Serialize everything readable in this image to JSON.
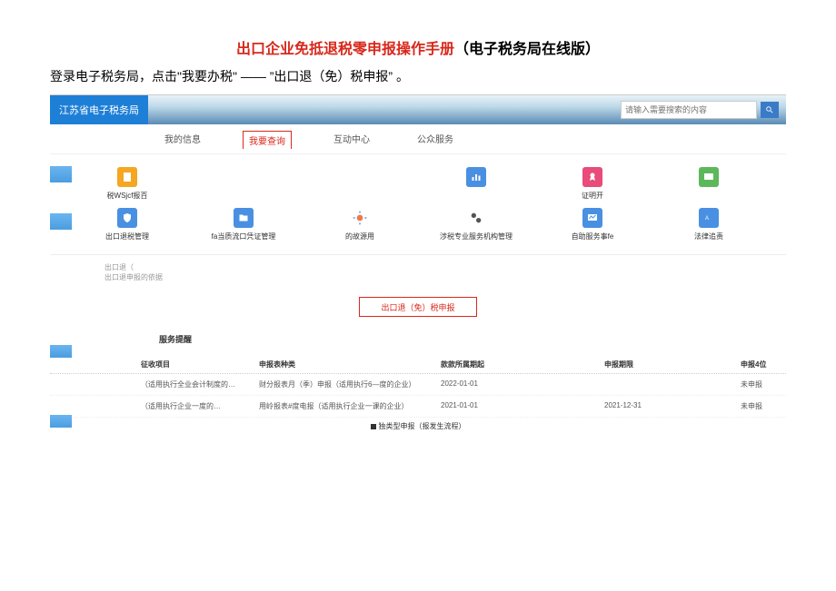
{
  "doc": {
    "title_red": "出口企业免抵退税零申报操作手册",
    "title_black": "（电子税务局在线版）",
    "intro_prefix": "登录电子税务局，点击\"我要办税\"",
    "intro_arrow": " —— ",
    "intro_quoted": "”出口退（免）税申报”",
    "intro_suffix": " 。"
  },
  "header": {
    "logo": "江苏省电子税务局",
    "search_placeholder": "请输入需要搜索的内容"
  },
  "nav": {
    "items": [
      "我的信息",
      "我要查询",
      "互动中心",
      "公众服务"
    ],
    "active_index": 1
  },
  "icons_row1": [
    {
      "label": "税WSjcf报百",
      "color": "#f5a623"
    },
    {
      "label": "",
      "color": ""
    },
    {
      "label": "",
      "color": ""
    },
    {
      "label": "",
      "color": "#4a90e2"
    },
    {
      "label": "证明开",
      "color": "#e94b7a"
    },
    {
      "label": "",
      "color": "#5db85c"
    }
  ],
  "icons_row2": [
    {
      "label": "出口退税管理",
      "color": "#4a90e2"
    },
    {
      "label": "fa当质流口凭证管理",
      "color": "#4a90e2"
    },
    {
      "label": "的故源用",
      "color": "#f07848"
    },
    {
      "label": "涉税专业服务机构管理",
      "color": "#555"
    },
    {
      "label": "自助服务事fe",
      "color": "#4a90e2"
    },
    {
      "label": "法律追责",
      "color": "#4a90e2"
    }
  ],
  "section": {
    "line1": "出口退（",
    "line2": "出口退申报的依据"
  },
  "highlight_button": "出口退（免）税申报",
  "reminder": {
    "title": "服务提醒",
    "headers": [
      "征收项目",
      "申报表种类",
      "款款所属期起",
      "申报期限",
      "申报4位"
    ],
    "rows": [
      {
        "c1": "（适用执行全业会计制度的…",
        "c2": "财分报表月（季）申报（适用执行6—度的企业）",
        "c3": "2022-01-01",
        "c4": "",
        "c5": "未申报"
      },
      {
        "c1": "（适用执行企业一度的…",
        "c2": "用岭报表#度电报（适用执行企业一课的企业）",
        "c3": "2021-01-01",
        "c4": "2021-12-31",
        "c5": "未申报"
      }
    ]
  },
  "footer": "独类型申报（报发生流程）"
}
